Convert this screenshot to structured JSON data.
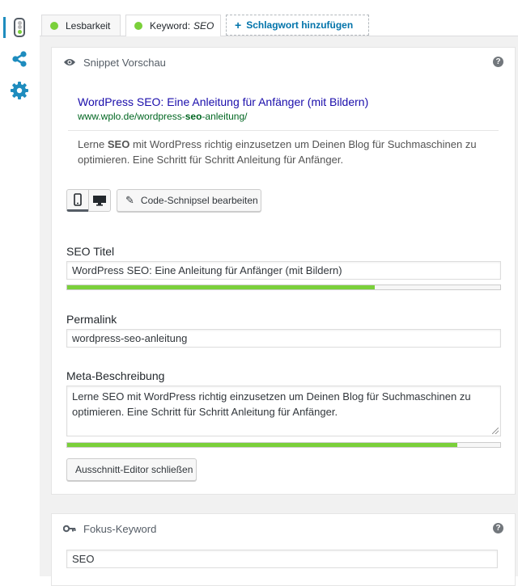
{
  "colors": {
    "accent": "#1e8cbe",
    "link": "#0073aa",
    "good": "#7ad03a",
    "snippet_title": "#1a0dab",
    "snippet_url": "#006621"
  },
  "sidebar": {
    "items": [
      {
        "icon": "traffic-light-icon",
        "active": true
      },
      {
        "icon": "share-icon",
        "active": false
      },
      {
        "icon": "gear-icon",
        "active": false
      }
    ]
  },
  "tabs": {
    "readability": {
      "label": "Lesbarkeit"
    },
    "keyword": {
      "prefix": "Keyword:",
      "value": "SEO"
    },
    "add": {
      "label": "Schlagwort hinzufügen"
    }
  },
  "snippet": {
    "header": "Snippet Vorschau",
    "help": "?",
    "title": "WordPress SEO: Eine Anleitung für Anfänger (mit Bildern)",
    "url_prefix": "www.wplo.de/wordpress-",
    "url_bold": "seo",
    "url_suffix": "-anleitung/",
    "desc_prefix": "Lerne ",
    "desc_bold": "SEO",
    "desc_rest": " mit WordPress richtig einzusetzen um Deinen Blog für Suchmaschinen zu optimieren. Eine Schritt für Schritt Anleitung für Anfänger.",
    "edit_button": "Code-Schnipsel bearbeiten",
    "preview_mode": "mobile"
  },
  "editor": {
    "seo_title": {
      "label": "SEO Titel",
      "value": "WordPress SEO: Eine Anleitung für Anfänger (mit Bildern)",
      "progress": 0.71
    },
    "slug": {
      "label": "Permalink",
      "value": "wordpress-seo-anleitung"
    },
    "meta_desc": {
      "label": "Meta-Beschreibung",
      "value": "Lerne SEO mit WordPress richtig einzusetzen um Deinen Blog für Suchmaschinen zu optimieren. Eine Schritt für Schritt Anleitung für Anfänger.",
      "progress": 0.9
    },
    "close_button": "Ausschnitt-Editor schließen"
  },
  "focus": {
    "header": "Fokus-Keyword",
    "help": "?",
    "value": "SEO"
  }
}
